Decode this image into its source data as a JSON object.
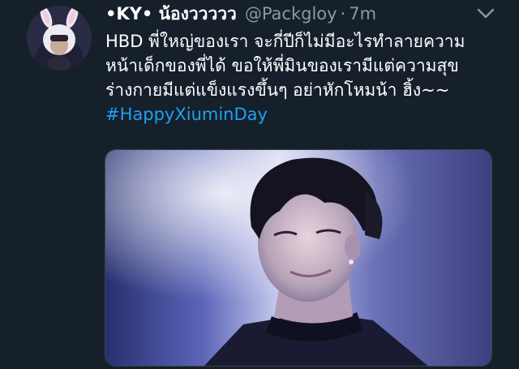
{
  "tweet": {
    "display_name": "•KY• น้องววววว",
    "handle": "@Packgloy",
    "separator": "·",
    "time": "7m",
    "text_lines": [
      "HBD พี่ใหญ่ของเรา จะกี่ปีก็ไม่มีอะไรทำลายความ",
      "หน้าเด็กของพี่ได้ ขอให้พี่มินของเรามีแต่ความสุข",
      "ร่างกายมีแต่แข็งแรงขึ้นๆ อย่าหักโหมน้า ฮิ้ง~~"
    ],
    "hashtag": "#HappyXiuminDay"
  },
  "icons": {
    "menu": "chevron-down-icon"
  },
  "colors": {
    "background": "#15202b",
    "text": "#ffffff",
    "secondary_text": "#8899a6",
    "link": "#1da1f2"
  }
}
